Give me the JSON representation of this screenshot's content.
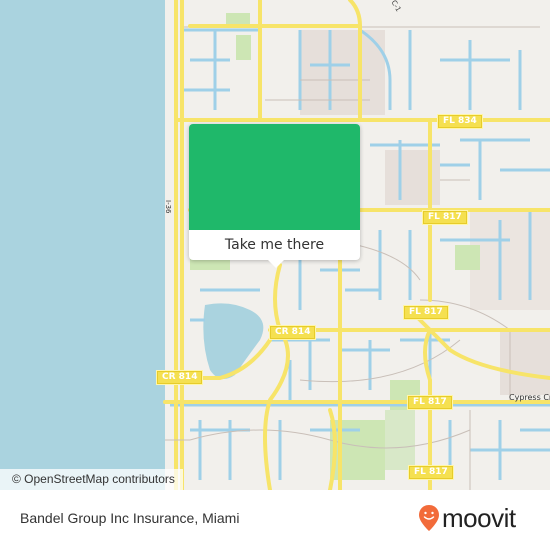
{
  "map": {
    "attribution": "© OpenStreetMap contributors",
    "road_labels": {
      "fl834": "FL 834",
      "fl817_a": "FL 817",
      "fl817_b": "FL 817",
      "fl817_c": "FL 817",
      "fl817_d": "FL 817",
      "cr814_a": "CR 814",
      "cr814_b": "CR 814",
      "i36": "I-36"
    },
    "place_labels": {
      "cypress_creek": "Cypress Cre",
      "c1": "C-1"
    },
    "colors": {
      "water": "#aad3df",
      "land": "#f2f0ec",
      "major_road": "#f7e469",
      "canal": "#9fd0e8",
      "park": "#cde6b4",
      "residential": "#e6dfda"
    }
  },
  "popup": {
    "button_label": "Take me there",
    "color": "#1fb86a"
  },
  "footer": {
    "title": "Bandel Group Inc Insurance, Miami",
    "brand": "moovit",
    "brand_color": "#f26b3a"
  }
}
